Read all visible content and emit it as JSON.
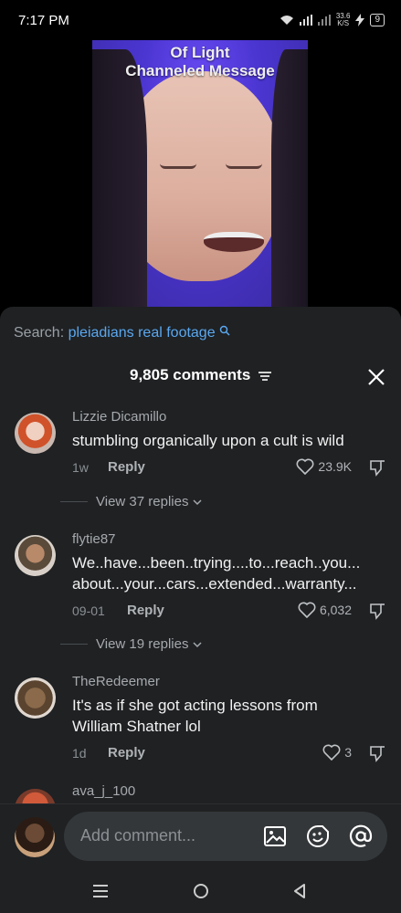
{
  "status_bar": {
    "time": "7:17 PM",
    "speed_value": "33.6",
    "speed_unit": "K/S",
    "battery": "9"
  },
  "video": {
    "caption_line1": "Of Light",
    "caption_line2": "Channeled Message"
  },
  "search": {
    "label": "Search:",
    "query": "pleiadians real footage"
  },
  "header": {
    "comment_count": "9,805 comments"
  },
  "comments": [
    {
      "user": "Lizzie Dicamillo",
      "text": [
        "stumbling organically upon a cult is wild"
      ],
      "date": "1w",
      "reply": "Reply",
      "likes": "23.9K",
      "view_replies": "View 37 replies"
    },
    {
      "user": "flytie87",
      "text": [
        "We..have...been..trying....to...reach..you...",
        "about...your...cars...extended...warranty..."
      ],
      "date": "09-01",
      "reply": "Reply",
      "likes": "6,032",
      "view_replies": "View 19 replies"
    },
    {
      "user": "TheRedeemer",
      "text": [
        "It's as if she got acting lessons from",
        "William Shatner lol"
      ],
      "date": "1d",
      "reply": "Reply",
      "likes": "3"
    },
    {
      "user": "ava_j_100"
    }
  ],
  "input": {
    "placeholder": "Add comment..."
  },
  "colors": {
    "accent_link": "#5aa8f0",
    "sheet_bg": "#1f2123",
    "video_bg": "#4a35d0"
  }
}
